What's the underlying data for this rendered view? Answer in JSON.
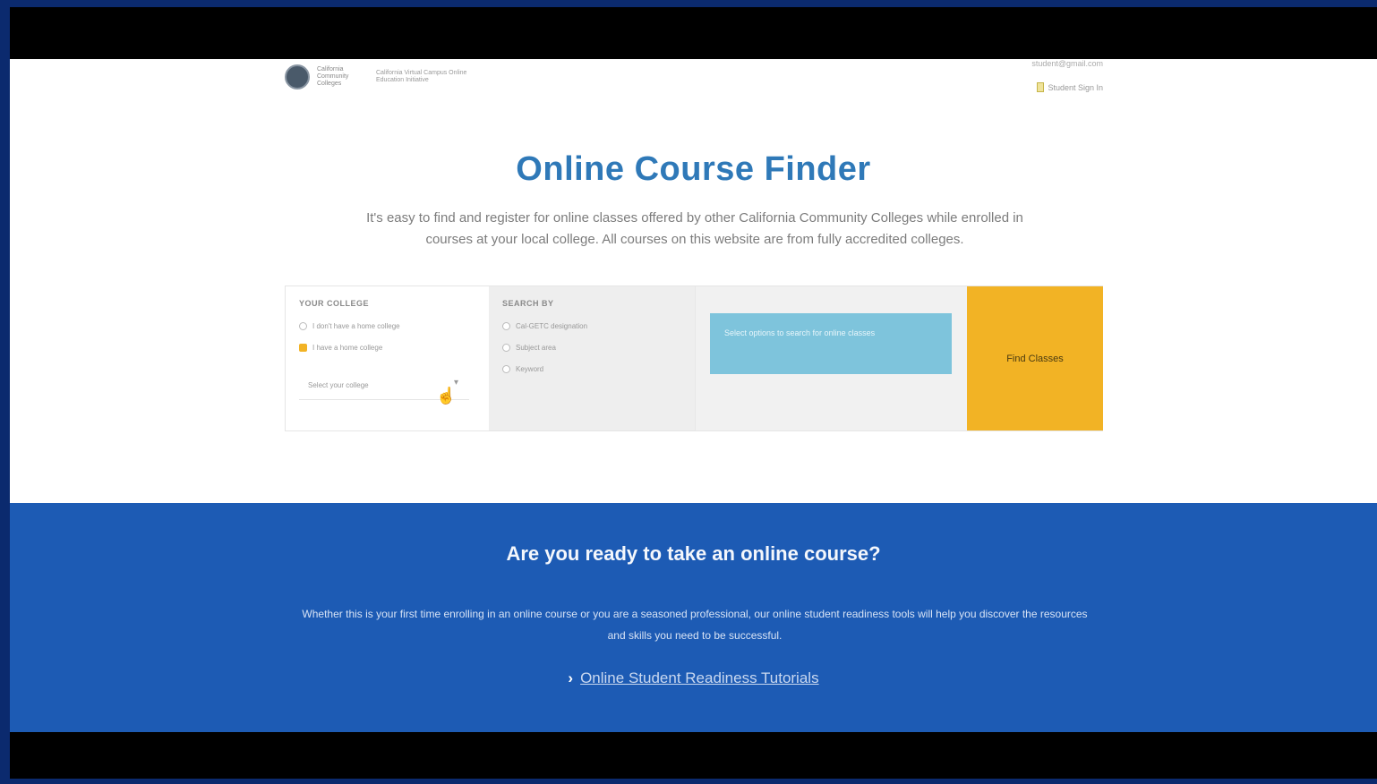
{
  "header": {
    "logo_name": "California Community Colleges",
    "logo_tagline": "California Virtual Campus Online Education Initiative",
    "account_email": "student@gmail.com",
    "signin_label": "Student Sign In"
  },
  "hero": {
    "title": "Online Course Finder",
    "description": "It's easy to find and register for online classes offered by other California Community Colleges while enrolled in courses at your local college. All courses on this website are from fully accredited colleges."
  },
  "finder": {
    "college_label": "YOUR COLLEGE",
    "college_options": [
      "I don't have a home college",
      "I have a home college"
    ],
    "college_select_value": "Select your college",
    "search_label": "SEARCH BY",
    "search_options": [
      "Cal-GETC designation",
      "Subject area",
      "Keyword"
    ],
    "results_message": "Select options to search for online classes",
    "find_button": "Find Classes"
  },
  "banner": {
    "title": "Are you ready to take an online course?",
    "description": "Whether this is your first time enrolling in an online course or you are a seasoned professional, our online student readiness tools will help you discover the resources and skills you need to be successful.",
    "link": "Online Student Readiness Tutorials"
  },
  "colors": {
    "title_blue": "#2f79b8",
    "banner_blue": "#1d5bb4",
    "accent_gold": "#f2b325",
    "info_blue": "#7ec4dc",
    "frame_navy": "#0b2a6e"
  }
}
